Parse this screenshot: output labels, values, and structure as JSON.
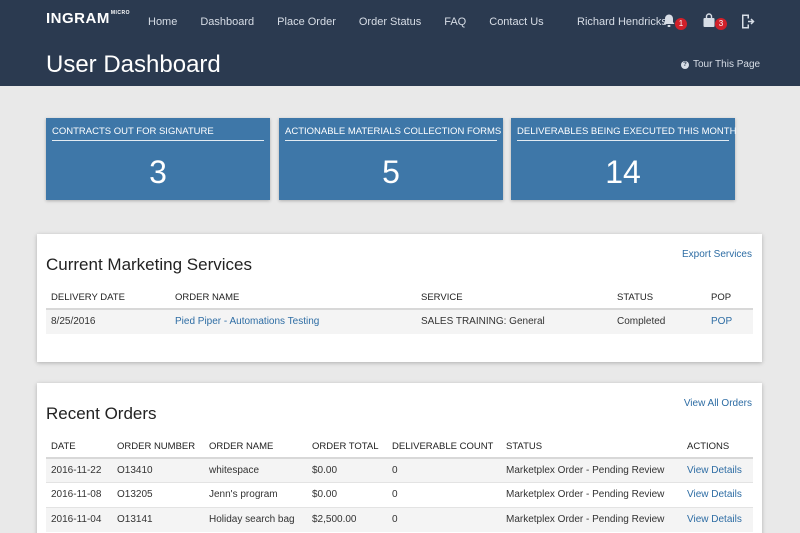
{
  "brand": {
    "logo_text": "INGRAM",
    "logo_sub": "MICRO"
  },
  "nav": {
    "items": [
      "Home",
      "Dashboard",
      "Place Order",
      "Order Status",
      "FAQ",
      "Contact Us"
    ]
  },
  "user": {
    "name": "Richard Hendricks",
    "notifications_count": "1",
    "cart_count": "3",
    "logout_icon": "logout-icon"
  },
  "header": {
    "title": "User Dashboard",
    "tour_label": "Tour This Page"
  },
  "stats": [
    {
      "label": "CONTRACTS OUT FOR SIGNATURE",
      "value": "3"
    },
    {
      "label": "ACTIONABLE MATERIALS COLLECTION FORMS",
      "value": "5"
    },
    {
      "label": "DELIVERABLES BEING EXECUTED THIS MONTH",
      "value": "14"
    }
  ],
  "marketing": {
    "title": "Current Marketing Services",
    "export_label": "Export Services",
    "columns": [
      "DELIVERY DATE",
      "ORDER NAME",
      "SERVICE",
      "STATUS",
      "POP"
    ],
    "rows": [
      {
        "delivery_date": "8/25/2016",
        "order_name": "Pied Piper - Automations Testing",
        "service": "SALES TRAINING: General",
        "status": "Completed",
        "pop": "POP"
      }
    ]
  },
  "orders": {
    "title": "Recent Orders",
    "view_all_label": "View All Orders",
    "columns": [
      "DATE",
      "ORDER NUMBER",
      "ORDER NAME",
      "ORDER TOTAL",
      "DELIVERABLE COUNT",
      "STATUS",
      "ACTIONS"
    ],
    "rows": [
      {
        "date": "2016-11-22",
        "number": "O13410",
        "name": "whitespace",
        "total": "$0.00",
        "count": "0",
        "status": "Marketplex Order - Pending Review",
        "action": "View Details"
      },
      {
        "date": "2016-11-08",
        "number": "O13205",
        "name": "Jenn's program",
        "total": "$0.00",
        "count": "0",
        "status": "Marketplex Order - Pending Review",
        "action": "View Details"
      },
      {
        "date": "2016-11-04",
        "number": "O13141",
        "name": "Holiday search bag",
        "total": "$2,500.00",
        "count": "0",
        "status": "Marketplex Order - Pending Review",
        "action": "View Details"
      }
    ]
  },
  "colors": {
    "header_bg": "#2b3a50",
    "stat_bg": "#3e77a8",
    "link": "#2e6da4",
    "badge": "#d0202a"
  }
}
